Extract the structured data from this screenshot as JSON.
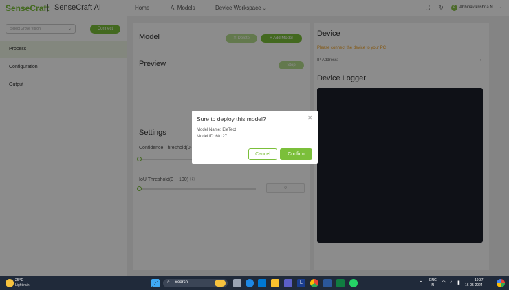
{
  "header": {
    "logo_sense": "Sense",
    "logo_craft": "Craft",
    "logo_sep": "|",
    "app_name": "SenseCraft AI",
    "nav": {
      "home": "Home",
      "ai_models": "AI Models",
      "device_workspace": "Device Workspace"
    },
    "user_initial": "A",
    "user_name": "Abhinav krishna N"
  },
  "sidebar": {
    "device_select_placeholder": "Select Grove Vision",
    "connect_label": "Connect",
    "items": [
      {
        "label": "Process"
      },
      {
        "label": "Configuration"
      },
      {
        "label": "Output"
      }
    ]
  },
  "main": {
    "model_title": "Model",
    "delete_label": "Delete",
    "add_model_label": "Add Model",
    "preview_title": "Preview",
    "preview_btn": "Stop",
    "settings_title": "Settings",
    "confidence_label": "Confidence Threshold(0 ~ 100)",
    "iou_label": "IoU Threshold(0 ~ 100)",
    "confidence_value": 0,
    "iou_value": 0,
    "iou_input": "0"
  },
  "device": {
    "title": "Device",
    "warning": "Please connect the device to your PC",
    "ip_label": "IP Address:",
    "logger_title": "Device Logger"
  },
  "modal": {
    "title": "Sure to deploy this model?",
    "model_name": "Model Name: EleTect",
    "model_id": "Model ID: 60127",
    "cancel": "Cancel",
    "confirm": "Confirm"
  },
  "taskbar": {
    "temperature": "25°C",
    "weather": "Light rain",
    "search": "Search",
    "lang_top": "ENG",
    "lang_bottom": "IN",
    "time": "19:37",
    "date": "16-05-2024"
  },
  "colors": {
    "accent": "#7bbf3a",
    "warning": "#f0a020",
    "logger_bg": "#1c1f2a"
  }
}
